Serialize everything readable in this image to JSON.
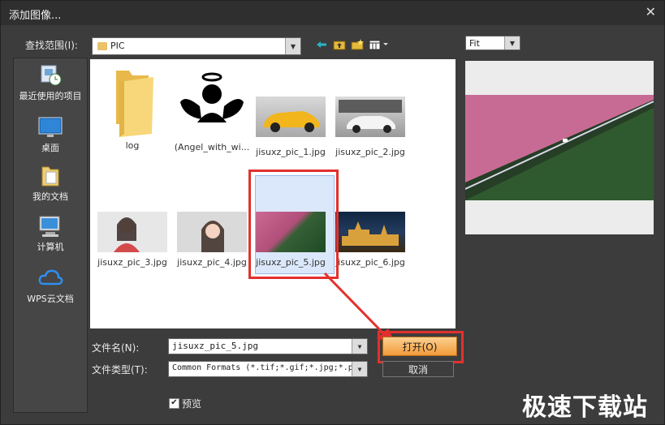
{
  "window": {
    "title": "添加图像...",
    "close_glyph": "✕"
  },
  "lookin": {
    "label": "查找范围(I):",
    "value": "PIC"
  },
  "places": [
    {
      "label": "最近使用的项目",
      "icon": "recent-icon"
    },
    {
      "label": "桌面",
      "icon": "desktop-icon"
    },
    {
      "label": "我的文档",
      "icon": "documents-icon"
    },
    {
      "label": "计算机",
      "icon": "computer-icon"
    },
    {
      "label": "WPS云文档",
      "icon": "cloud-icon"
    }
  ],
  "files": [
    {
      "label": "log",
      "kind": "folder"
    },
    {
      "label": "(Angel_with_wi...",
      "kind": "angel"
    },
    {
      "label": "jisuxz_pic_1.jpg",
      "kind": "car-yellow"
    },
    {
      "label": "jisuxz_pic_2.jpg",
      "kind": "car-white"
    },
    {
      "label": "jisuxz_pic_3.jpg",
      "kind": "portrait"
    },
    {
      "label": "jisuxz_pic_4.jpg",
      "kind": "portrait2"
    },
    {
      "label": "jisuxz_pic_5.jpg",
      "kind": "forest"
    },
    {
      "label": "jisuxz_pic_6.jpg",
      "kind": "city"
    }
  ],
  "selected_file": "jisuxz_pic_5.jpg",
  "preview": {
    "zoom": "Fit"
  },
  "filename": {
    "label": "文件名(N):",
    "value": "jisuxz_pic_5.jpg"
  },
  "filetype": {
    "label": "文件类型(T):",
    "value": "Common Formats (*.tif;*.gif;*.jpg;*.p"
  },
  "buttons": {
    "open": "打开(O)",
    "cancel": "取消"
  },
  "preview_checkbox": {
    "label": "预览",
    "checked": true,
    "check_glyph": "✔"
  },
  "watermark": "极速下载站",
  "colors": {
    "highlight": "#e2312d",
    "open_button": "#f6a84a"
  }
}
